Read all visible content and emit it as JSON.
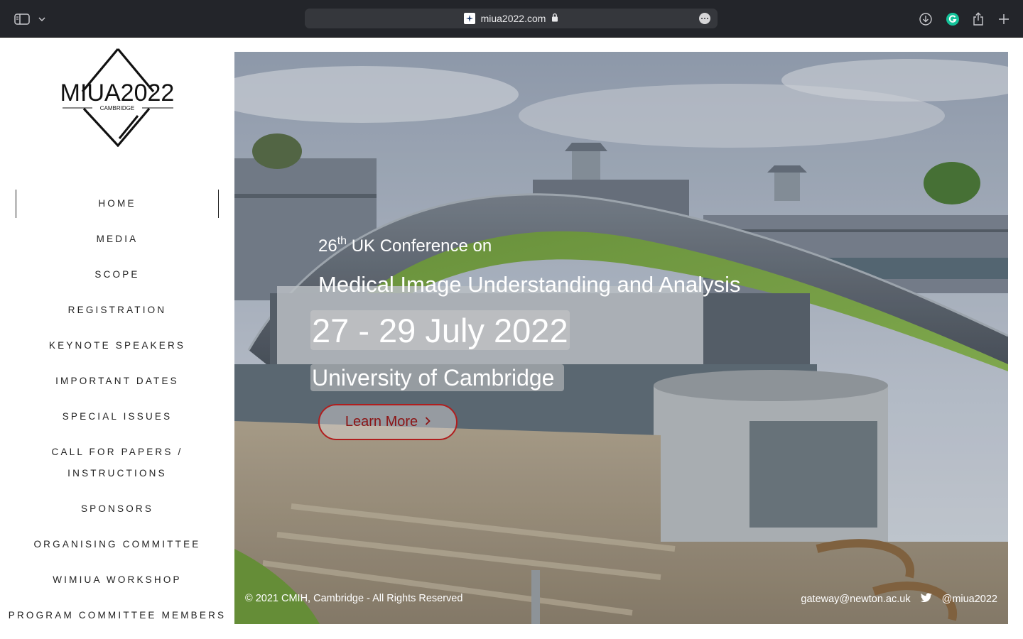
{
  "browser": {
    "url": "miua2022.com",
    "icons": [
      "sidebar-toggle-icon",
      "chevron-down-icon",
      "lock-icon",
      "more-icon",
      "download-icon",
      "grammarly-icon",
      "share-icon",
      "new-tab-icon"
    ]
  },
  "logo": {
    "title": "MIUA2022",
    "subtitle": "CAMBRIDGE"
  },
  "nav": {
    "items": [
      {
        "label": "HOME",
        "active": true
      },
      {
        "label": "MEDIA"
      },
      {
        "label": "SCOPE"
      },
      {
        "label": "REGISTRATION"
      },
      {
        "label": "KEYNOTE SPEAKERS"
      },
      {
        "label": "IMPORTANT DATES"
      },
      {
        "label": "SPECIAL ISSUES"
      },
      {
        "label": "CALL FOR PAPERS /"
      },
      {
        "label": "INSTRUCTIONS"
      },
      {
        "label": "SPONSORS"
      },
      {
        "label": "ORGANISING COMMITTEE"
      },
      {
        "label": "WIMIUA WORKSHOP"
      },
      {
        "label": "PROGRAM COMMITTEE MEMBERS"
      }
    ]
  },
  "hero": {
    "ordinal_number": "26",
    "ordinal_suffix": "th",
    "line1_rest": " UK Conference on",
    "line2": "Medical Image Understanding and Analysis",
    "dates": "27 - 29 July 2022",
    "place": "University of Cambridge",
    "button_label": "Learn More",
    "accent_color": "#b01e1e"
  },
  "footer": {
    "copyright": "© 2021 CMIH, Cambridge - All Rights Reserved",
    "email": "gateway@newton.ac.uk",
    "twitter": "@miua2022"
  }
}
